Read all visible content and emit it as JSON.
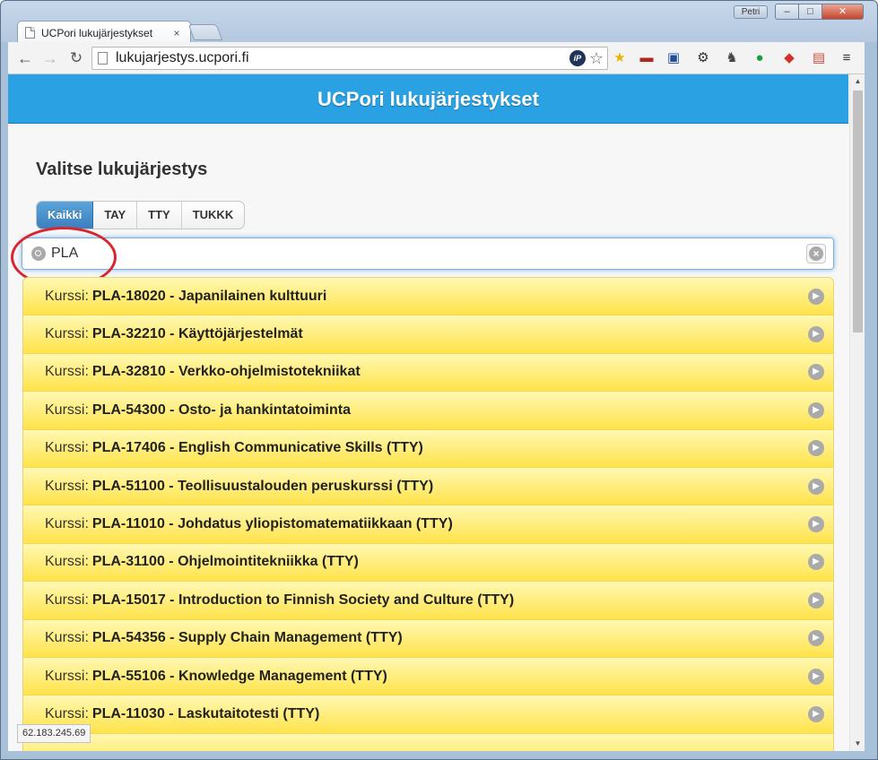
{
  "browser": {
    "tab_title": "UCPori lukujärjestykset",
    "tab_close": "×",
    "profile_name": "Petri",
    "url": "lukujarjestys.ucpori.fi",
    "status_text": "62.183.245.69"
  },
  "header": {
    "title": "UCPori lukujärjestykset"
  },
  "page": {
    "heading": "Valitse lukujärjestys"
  },
  "filters": [
    {
      "label": "Kaikki",
      "active": true
    },
    {
      "label": "TAY",
      "active": false
    },
    {
      "label": "TTY",
      "active": false
    },
    {
      "label": "TUKKK",
      "active": false
    }
  ],
  "search": {
    "value": "PLA"
  },
  "courses": [
    {
      "prefix": "Kurssi:",
      "name": "PLA-18020 - Japanilainen kulttuuri"
    },
    {
      "prefix": "Kurssi:",
      "name": "PLA-32210 - Käyttöjärjestelmät"
    },
    {
      "prefix": "Kurssi:",
      "name": "PLA-32810 - Verkko-ohjelmistotekniikat"
    },
    {
      "prefix": "Kurssi:",
      "name": "PLA-54300 - Osto- ja hankintatoiminta"
    },
    {
      "prefix": "Kurssi:",
      "name": "PLA-17406 - English Communicative Skills (TTY)"
    },
    {
      "prefix": "Kurssi:",
      "name": "PLA-51100 - Teollisuustalouden peruskurssi (TTY)"
    },
    {
      "prefix": "Kurssi:",
      "name": "PLA-11010 - Johdatus yliopistomatematiikkaan (TTY)"
    },
    {
      "prefix": "Kurssi:",
      "name": "PLA-31100 - Ohjelmointitekniikka (TTY)"
    },
    {
      "prefix": "Kurssi:",
      "name": "PLA-15017 - Introduction to Finnish Society and Culture (TTY)"
    },
    {
      "prefix": "Kurssi:",
      "name": "PLA-54356 - Supply Chain Management (TTY)"
    },
    {
      "prefix": "Kurssi:",
      "name": "PLA-55106 - Knowledge Management (TTY)"
    },
    {
      "prefix": "Kurssi:",
      "name": "PLA-11030 - Laskutaitotesti (TTY)"
    }
  ],
  "colors": {
    "header_bg": "#29a1e2",
    "active_filter_bg": "#3b7fbf",
    "course_bg": "#ffe34a",
    "annotation": "#d8262e"
  },
  "icons": {
    "back": "arrow-left",
    "forward": "arrow-right",
    "reload": "reload",
    "search": "magnifier",
    "clear": "close-circle",
    "course_arrow": "chevron-right-circle"
  }
}
